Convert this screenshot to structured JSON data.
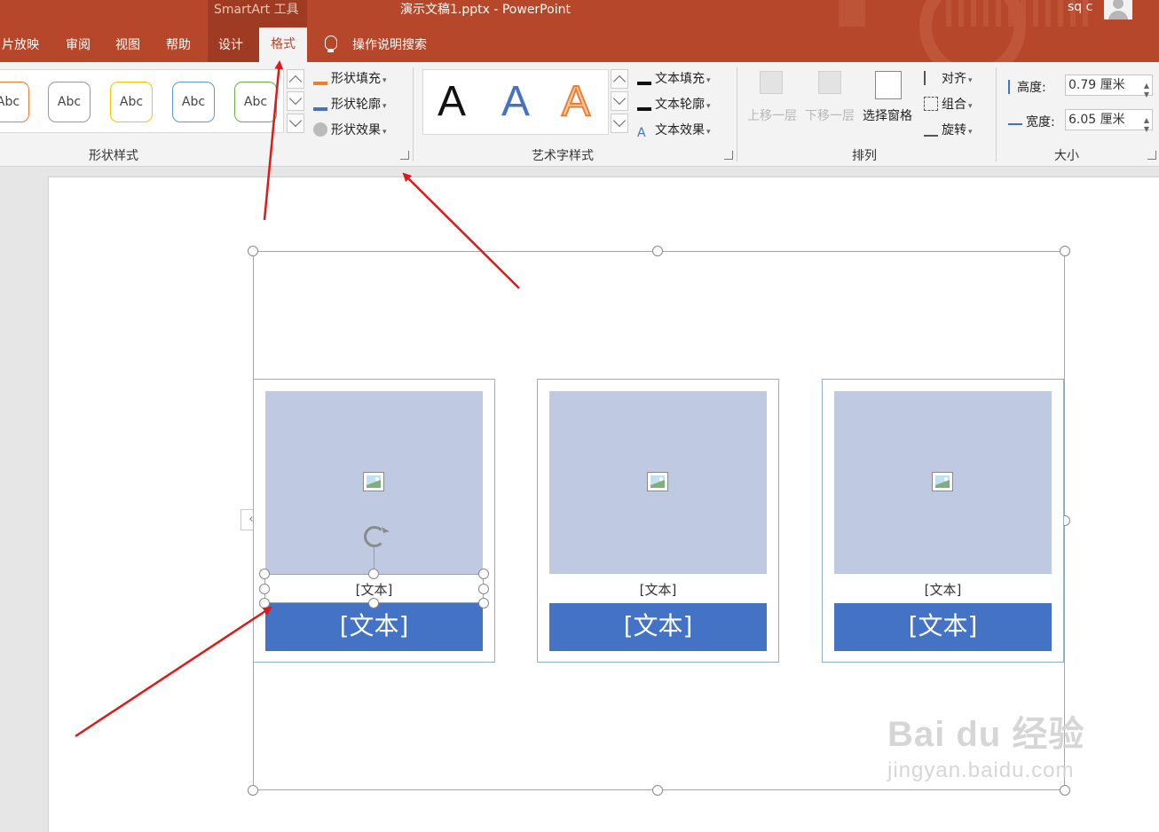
{
  "window": {
    "contextual_label": "SmartArt 工具",
    "document_title": "演示文稿1.pptx  -  PowerPoint",
    "user_name": "sq c",
    "accent": "#b7472a"
  },
  "tabs": [
    {
      "label": "片放映"
    },
    {
      "label": "审阅"
    },
    {
      "label": "视图"
    },
    {
      "label": "帮助"
    },
    {
      "label": "设计"
    },
    {
      "label": "格式",
      "active": true
    }
  ],
  "tell_me": "操作说明搜索",
  "ribbon": {
    "shape_styles": {
      "items": [
        "Abc",
        "Abc",
        "Abc",
        "Abc",
        "Abc"
      ],
      "fill": "形状填充",
      "outline": "形状轮廓",
      "effects": "形状效果",
      "label": "形状样式"
    },
    "wordart": {
      "samples": [
        "A",
        "A",
        "A"
      ],
      "fill": "文本填充",
      "outline": "文本轮廓",
      "effects": "文本效果",
      "label": "艺术字样式"
    },
    "arrange": {
      "bring_forward": "上移一层",
      "send_backward": "下移一层",
      "selection_pane": "选择窗格",
      "align": "对齐",
      "group": "组合",
      "rotate": "旋转",
      "label": "排列"
    },
    "size": {
      "height_label": "高度:",
      "height_value": "0.79 厘米",
      "width_label": "宽度:",
      "width_value": "6.05 厘米",
      "label": "大小"
    }
  },
  "smartart": {
    "cards": [
      {
        "caption": "[文本]",
        "bar": "[文本]"
      },
      {
        "caption": "[文本]",
        "bar": "[文本]"
      },
      {
        "caption": "[文本]",
        "bar": "[文本]"
      }
    ],
    "fill_color": "#bfc9e2",
    "bar_color": "#4472c4"
  },
  "watermark": {
    "main": "Bai du 经验",
    "sub": "jingyan.baidu.com"
  }
}
